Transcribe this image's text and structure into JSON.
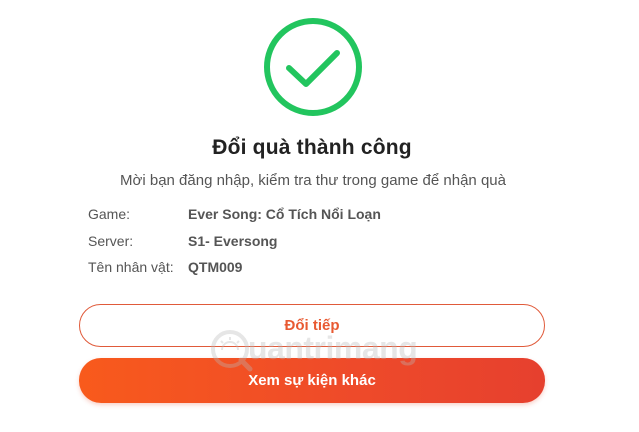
{
  "dialog": {
    "title": "Đổi quà thành công",
    "subtitle": "Mời bạn đăng nhập, kiểm tra thư trong game để nhận quà",
    "status_color": "#22c55e",
    "icon": "check-circle-icon"
  },
  "info": {
    "game_label": "Game:",
    "game_value": "Ever Song: Cổ Tích Nổi Loạn",
    "server_label": "Server:",
    "server_value": "S1- Eversong",
    "character_label": "Tên nhân vật:",
    "character_value": "QTM009"
  },
  "buttons": {
    "continue_label": "Đổi tiếp",
    "more_events_label": "Xem sự kiện khác",
    "accent_color": "#f05a28"
  },
  "watermark": {
    "text": "uantrimang",
    "icon": "quantrimang-logo"
  }
}
